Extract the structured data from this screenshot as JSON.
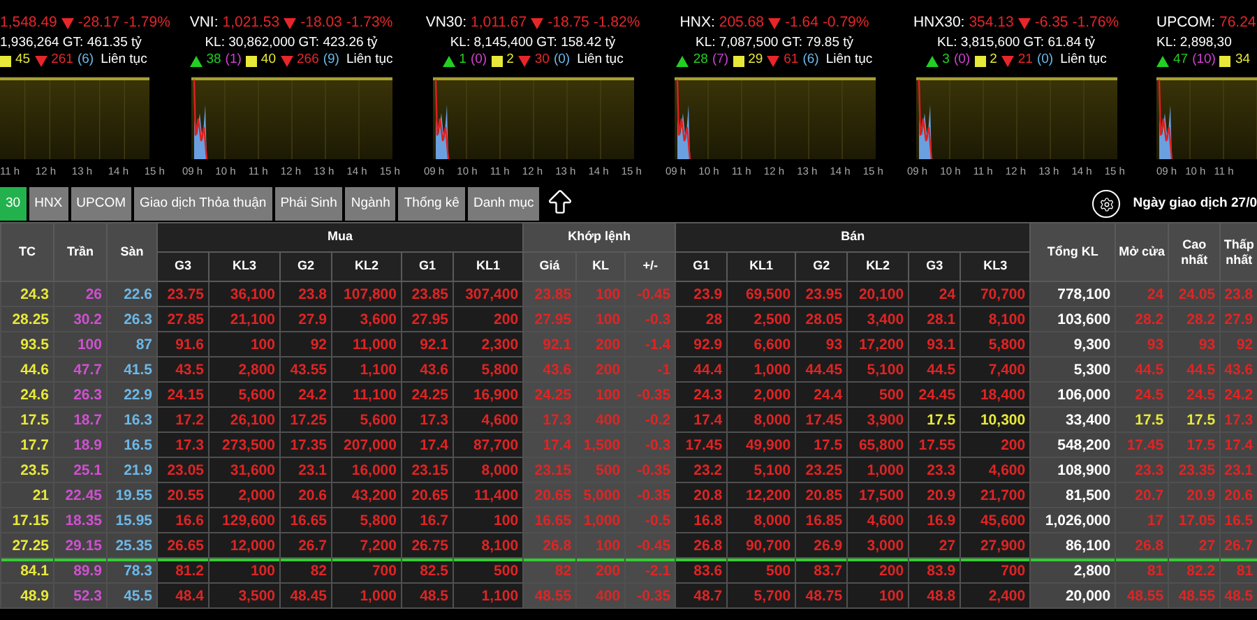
{
  "indices": [
    {
      "cut_left": true,
      "value": "1,548.49",
      "down": true,
      "change": "-28.17",
      "percent": "-1.79%",
      "stats": "1,936,264 GT: 461.35 tỷ",
      "breadth": {
        "unchanged": "45",
        "declines": "261",
        "floor": "(6)",
        "session": "Liên tục"
      },
      "x_labels": [
        "11 h",
        "12 h",
        "13 h",
        "14 h",
        "15 h"
      ]
    },
    {
      "label": "VNI:",
      "value": "1,021.53",
      "down": true,
      "change": "-18.03",
      "percent": "-1.73%",
      "stats": "KL: 30,862,000 GT: 423.26 tỷ",
      "breadth": {
        "advances": "38",
        "ceiling": "(1)",
        "unchanged": "40",
        "declines": "266",
        "floor": "(9)",
        "session": "Liên tục"
      },
      "x_labels": [
        "09 h",
        "10 h",
        "11 h",
        "12 h",
        "13 h",
        "14 h",
        "15 h"
      ]
    },
    {
      "label": "VN30:",
      "value": "1,011.67",
      "down": true,
      "change": "-18.75",
      "percent": "-1.82%",
      "stats": "KL: 8,145,400 GT: 158.42 tỷ",
      "breadth": {
        "advances": "1",
        "ceiling": "(0)",
        "unchanged": "2",
        "declines": "30",
        "floor": "(0)",
        "session": "Liên tục"
      },
      "x_labels": [
        "09 h",
        "10 h",
        "11 h",
        "12 h",
        "13 h",
        "14 h",
        "15 h"
      ]
    },
    {
      "label": "HNX:",
      "value": "205.68",
      "down": true,
      "change": "-1.64",
      "percent": "-0.79%",
      "stats": "KL: 7,087,500 GT: 79.85 tỷ",
      "breadth": {
        "advances": "28",
        "ceiling": "(7)",
        "unchanged": "29",
        "declines": "61",
        "floor": "(6)",
        "session": "Liên tục"
      },
      "x_labels": [
        "09 h",
        "10 h",
        "11 h",
        "12 h",
        "13 h",
        "14 h",
        "15 h"
      ]
    },
    {
      "label": "HNX30:",
      "value": "354.13",
      "down": true,
      "change": "-6.35",
      "percent": "-1.76%",
      "stats": "KL: 3,815,600 GT: 61.84 tỷ",
      "breadth": {
        "advances": "3",
        "ceiling": "(0)",
        "unchanged": "2",
        "declines": "21",
        "floor": "(0)",
        "session": "Liên tục"
      },
      "x_labels": [
        "09 h",
        "10 h",
        "11 h",
        "12 h",
        "13 h",
        "14 h",
        "15 h"
      ]
    },
    {
      "cut_right": true,
      "label": "UPCOM:",
      "value": "76.24",
      "down": true,
      "stats": "KL: 2,898,30",
      "breadth": {
        "advances": "47",
        "ceiling": "(10)",
        "unchanged": "34"
      },
      "x_labels": [
        "09 h",
        "10 h",
        "11 h"
      ]
    }
  ],
  "tabs": [
    {
      "label": "30",
      "selected": true
    },
    {
      "label": "HNX",
      "selected": false
    },
    {
      "label": "UPCOM",
      "selected": false
    },
    {
      "label": "Giao dịch Thỏa thuận",
      "selected": false
    },
    {
      "label": "Phái Sinh",
      "selected": false
    },
    {
      "label": "Ngành",
      "selected": false
    },
    {
      "label": "Thống kê",
      "selected": false
    },
    {
      "label": "Danh mục",
      "selected": false
    }
  ],
  "trading_date": "Ngày giao dịch 27/0",
  "table": {
    "groups": [
      {
        "kind": "single",
        "label": "TC"
      },
      {
        "kind": "single",
        "label": "Trần"
      },
      {
        "kind": "single",
        "label": "Sàn"
      },
      {
        "kind": "buy",
        "label": "Mua",
        "columns": [
          "G3",
          "KL3",
          "G2",
          "KL2",
          "G1",
          "KL1"
        ]
      },
      {
        "kind": "match",
        "label": "Khớp lệnh",
        "columns": [
          "Giá",
          "KL",
          "+/-"
        ]
      },
      {
        "kind": "sell",
        "label": "Bán",
        "columns": [
          "G1",
          "KL1",
          "G2",
          "KL2",
          "G3",
          "KL3"
        ]
      },
      {
        "kind": "single",
        "label": "Tổng KL"
      },
      {
        "kind": "single",
        "label": "Mở cửa"
      },
      {
        "kind": "single",
        "label": "Cao nhất"
      },
      {
        "kind": "single",
        "label": "Thấp nhất"
      }
    ],
    "rows": [
      {
        "separator_above": false,
        "cells": [
          {
            "text": "24.3",
            "color": "#e8e83a"
          },
          {
            "text": "26",
            "color": "#d050d0"
          },
          {
            "text": "22.6",
            "color": "#6cb8e8"
          },
          {
            "text": "23.75",
            "color": "#e02424"
          },
          {
            "text": "36,100",
            "color": "#e02424"
          },
          {
            "text": "23.8",
            "color": "#e02424"
          },
          {
            "text": "107,800",
            "color": "#e02424"
          },
          {
            "text": "23.85",
            "color": "#e02424"
          },
          {
            "text": "307,400",
            "color": "#e02424"
          },
          {
            "text": "23.85",
            "color": "#e02424"
          },
          {
            "text": "100",
            "color": "#e02424"
          },
          {
            "text": "-0.45",
            "color": "#e02424"
          },
          {
            "text": "23.9",
            "color": "#e02424"
          },
          {
            "text": "69,500",
            "color": "#e02424"
          },
          {
            "text": "23.95",
            "color": "#e02424"
          },
          {
            "text": "20,100",
            "color": "#e02424"
          },
          {
            "text": "24",
            "color": "#e02424"
          },
          {
            "text": "70,700",
            "color": "#e02424"
          },
          {
            "text": "778,100",
            "color": "#ffffff"
          },
          {
            "text": "24",
            "color": "#e02424"
          },
          {
            "text": "24.05",
            "color": "#e02424"
          },
          {
            "text": "23.8",
            "color": "#e02424"
          }
        ]
      },
      {
        "separator_above": false,
        "cells": [
          {
            "text": "28.25",
            "color": "#e8e83a"
          },
          {
            "text": "30.2",
            "color": "#d050d0"
          },
          {
            "text": "26.3",
            "color": "#6cb8e8"
          },
          {
            "text": "27.85",
            "color": "#e02424"
          },
          {
            "text": "21,100",
            "color": "#e02424"
          },
          {
            "text": "27.9",
            "color": "#e02424"
          },
          {
            "text": "3,600",
            "color": "#e02424"
          },
          {
            "text": "27.95",
            "color": "#e02424"
          },
          {
            "text": "200",
            "color": "#e02424"
          },
          {
            "text": "27.95",
            "color": "#e02424"
          },
          {
            "text": "100",
            "color": "#e02424"
          },
          {
            "text": "-0.3",
            "color": "#e02424"
          },
          {
            "text": "28",
            "color": "#e02424"
          },
          {
            "text": "2,500",
            "color": "#e02424"
          },
          {
            "text": "28.05",
            "color": "#e02424"
          },
          {
            "text": "3,400",
            "color": "#e02424"
          },
          {
            "text": "28.1",
            "color": "#e02424"
          },
          {
            "text": "8,100",
            "color": "#e02424"
          },
          {
            "text": "103,600",
            "color": "#ffffff"
          },
          {
            "text": "28.2",
            "color": "#e02424"
          },
          {
            "text": "28.2",
            "color": "#e02424"
          },
          {
            "text": "27.9",
            "color": "#e02424"
          }
        ]
      },
      {
        "separator_above": false,
        "cells": [
          {
            "text": "93.5",
            "color": "#e8e83a"
          },
          {
            "text": "100",
            "color": "#d050d0"
          },
          {
            "text": "87",
            "color": "#6cb8e8"
          },
          {
            "text": "91.6",
            "color": "#e02424"
          },
          {
            "text": "100",
            "color": "#e02424"
          },
          {
            "text": "92",
            "color": "#e02424"
          },
          {
            "text": "11,000",
            "color": "#e02424"
          },
          {
            "text": "92.1",
            "color": "#e02424"
          },
          {
            "text": "2,300",
            "color": "#e02424"
          },
          {
            "text": "92.1",
            "color": "#e02424"
          },
          {
            "text": "200",
            "color": "#e02424"
          },
          {
            "text": "-1.4",
            "color": "#e02424"
          },
          {
            "text": "92.9",
            "color": "#e02424"
          },
          {
            "text": "6,600",
            "color": "#e02424"
          },
          {
            "text": "93",
            "color": "#e02424"
          },
          {
            "text": "17,200",
            "color": "#e02424"
          },
          {
            "text": "93.1",
            "color": "#e02424"
          },
          {
            "text": "5,800",
            "color": "#e02424"
          },
          {
            "text": "9,300",
            "color": "#ffffff"
          },
          {
            "text": "93",
            "color": "#e02424"
          },
          {
            "text": "93",
            "color": "#e02424"
          },
          {
            "text": "92",
            "color": "#e02424"
          }
        ]
      },
      {
        "separator_above": false,
        "cells": [
          {
            "text": "44.6",
            "color": "#e8e83a"
          },
          {
            "text": "47.7",
            "color": "#d050d0"
          },
          {
            "text": "41.5",
            "color": "#6cb8e8"
          },
          {
            "text": "43.5",
            "color": "#e02424"
          },
          {
            "text": "2,800",
            "color": "#e02424"
          },
          {
            "text": "43.55",
            "color": "#e02424"
          },
          {
            "text": "1,100",
            "color": "#e02424"
          },
          {
            "text": "43.6",
            "color": "#e02424"
          },
          {
            "text": "5,800",
            "color": "#e02424"
          },
          {
            "text": "43.6",
            "color": "#e02424"
          },
          {
            "text": "200",
            "color": "#e02424"
          },
          {
            "text": "-1",
            "color": "#e02424"
          },
          {
            "text": "44.4",
            "color": "#e02424"
          },
          {
            "text": "1,000",
            "color": "#e02424"
          },
          {
            "text": "44.45",
            "color": "#e02424"
          },
          {
            "text": "5,100",
            "color": "#e02424"
          },
          {
            "text": "44.5",
            "color": "#e02424"
          },
          {
            "text": "7,400",
            "color": "#e02424"
          },
          {
            "text": "5,300",
            "color": "#ffffff"
          },
          {
            "text": "44.5",
            "color": "#e02424"
          },
          {
            "text": "44.5",
            "color": "#e02424"
          },
          {
            "text": "43.6",
            "color": "#e02424"
          }
        ]
      },
      {
        "separator_above": false,
        "cells": [
          {
            "text": "24.6",
            "color": "#e8e83a"
          },
          {
            "text": "26.3",
            "color": "#d050d0"
          },
          {
            "text": "22.9",
            "color": "#6cb8e8"
          },
          {
            "text": "24.15",
            "color": "#e02424"
          },
          {
            "text": "5,600",
            "color": "#e02424"
          },
          {
            "text": "24.2",
            "color": "#e02424"
          },
          {
            "text": "11,100",
            "color": "#e02424"
          },
          {
            "text": "24.25",
            "color": "#e02424"
          },
          {
            "text": "16,900",
            "color": "#e02424"
          },
          {
            "text": "24.25",
            "color": "#e02424"
          },
          {
            "text": "100",
            "color": "#e02424"
          },
          {
            "text": "-0.35",
            "color": "#e02424"
          },
          {
            "text": "24.3",
            "color": "#e02424"
          },
          {
            "text": "2,000",
            "color": "#e02424"
          },
          {
            "text": "24.4",
            "color": "#e02424"
          },
          {
            "text": "500",
            "color": "#e02424"
          },
          {
            "text": "24.45",
            "color": "#e02424"
          },
          {
            "text": "18,400",
            "color": "#e02424"
          },
          {
            "text": "106,000",
            "color": "#ffffff"
          },
          {
            "text": "24.5",
            "color": "#e02424"
          },
          {
            "text": "24.5",
            "color": "#e02424"
          },
          {
            "text": "24.2",
            "color": "#e02424"
          }
        ]
      },
      {
        "separator_above": false,
        "cells": [
          {
            "text": "17.5",
            "color": "#e8e83a"
          },
          {
            "text": "18.7",
            "color": "#d050d0"
          },
          {
            "text": "16.3",
            "color": "#6cb8e8"
          },
          {
            "text": "17.2",
            "color": "#e02424"
          },
          {
            "text": "26,100",
            "color": "#e02424"
          },
          {
            "text": "17.25",
            "color": "#e02424"
          },
          {
            "text": "5,600",
            "color": "#e02424"
          },
          {
            "text": "17.3",
            "color": "#e02424"
          },
          {
            "text": "4,600",
            "color": "#e02424"
          },
          {
            "text": "17.3",
            "color": "#e02424"
          },
          {
            "text": "400",
            "color": "#e02424"
          },
          {
            "text": "-0.2",
            "color": "#e02424"
          },
          {
            "text": "17.4",
            "color": "#e02424"
          },
          {
            "text": "8,000",
            "color": "#e02424"
          },
          {
            "text": "17.45",
            "color": "#e02424"
          },
          {
            "text": "3,900",
            "color": "#e02424"
          },
          {
            "text": "17.5",
            "color": "#e8e83a"
          },
          {
            "text": "10,300",
            "color": "#e8e83a"
          },
          {
            "text": "33,400",
            "color": "#ffffff"
          },
          {
            "text": "17.5",
            "color": "#e8e83a"
          },
          {
            "text": "17.5",
            "color": "#e8e83a"
          },
          {
            "text": "17.3",
            "color": "#e02424"
          }
        ]
      },
      {
        "separator_above": false,
        "cells": [
          {
            "text": "17.7",
            "color": "#e8e83a"
          },
          {
            "text": "18.9",
            "color": "#d050d0"
          },
          {
            "text": "16.5",
            "color": "#6cb8e8"
          },
          {
            "text": "17.3",
            "color": "#e02424"
          },
          {
            "text": "273,500",
            "color": "#e02424"
          },
          {
            "text": "17.35",
            "color": "#e02424"
          },
          {
            "text": "207,000",
            "color": "#e02424"
          },
          {
            "text": "17.4",
            "color": "#e02424"
          },
          {
            "text": "87,700",
            "color": "#e02424"
          },
          {
            "text": "17.4",
            "color": "#e02424"
          },
          {
            "text": "1,500",
            "color": "#e02424"
          },
          {
            "text": "-0.3",
            "color": "#e02424"
          },
          {
            "text": "17.45",
            "color": "#e02424"
          },
          {
            "text": "49,900",
            "color": "#e02424"
          },
          {
            "text": "17.5",
            "color": "#e02424"
          },
          {
            "text": "65,800",
            "color": "#e02424"
          },
          {
            "text": "17.55",
            "color": "#e02424"
          },
          {
            "text": "200",
            "color": "#e02424"
          },
          {
            "text": "548,200",
            "color": "#ffffff"
          },
          {
            "text": "17.45",
            "color": "#e02424"
          },
          {
            "text": "17.5",
            "color": "#e02424"
          },
          {
            "text": "17.4",
            "color": "#e02424"
          }
        ]
      },
      {
        "separator_above": false,
        "cells": [
          {
            "text": "23.5",
            "color": "#e8e83a"
          },
          {
            "text": "25.1",
            "color": "#d050d0"
          },
          {
            "text": "21.9",
            "color": "#6cb8e8"
          },
          {
            "text": "23.05",
            "color": "#e02424"
          },
          {
            "text": "31,600",
            "color": "#e02424"
          },
          {
            "text": "23.1",
            "color": "#e02424"
          },
          {
            "text": "16,000",
            "color": "#e02424"
          },
          {
            "text": "23.15",
            "color": "#e02424"
          },
          {
            "text": "8,000",
            "color": "#e02424"
          },
          {
            "text": "23.15",
            "color": "#e02424"
          },
          {
            "text": "500",
            "color": "#e02424"
          },
          {
            "text": "-0.35",
            "color": "#e02424"
          },
          {
            "text": "23.2",
            "color": "#e02424"
          },
          {
            "text": "5,100",
            "color": "#e02424"
          },
          {
            "text": "23.25",
            "color": "#e02424"
          },
          {
            "text": "1,000",
            "color": "#e02424"
          },
          {
            "text": "23.3",
            "color": "#e02424"
          },
          {
            "text": "4,600",
            "color": "#e02424"
          },
          {
            "text": "108,900",
            "color": "#ffffff"
          },
          {
            "text": "23.3",
            "color": "#e02424"
          },
          {
            "text": "23.35",
            "color": "#e02424"
          },
          {
            "text": "23.1",
            "color": "#e02424"
          }
        ]
      },
      {
        "separator_above": false,
        "cells": [
          {
            "text": "21",
            "color": "#e8e83a"
          },
          {
            "text": "22.45",
            "color": "#d050d0"
          },
          {
            "text": "19.55",
            "color": "#6cb8e8"
          },
          {
            "text": "20.55",
            "color": "#e02424"
          },
          {
            "text": "2,000",
            "color": "#e02424"
          },
          {
            "text": "20.6",
            "color": "#e02424"
          },
          {
            "text": "43,200",
            "color": "#e02424"
          },
          {
            "text": "20.65",
            "color": "#e02424"
          },
          {
            "text": "11,400",
            "color": "#e02424"
          },
          {
            "text": "20.65",
            "color": "#e02424"
          },
          {
            "text": "5,000",
            "color": "#e02424"
          },
          {
            "text": "-0.35",
            "color": "#e02424"
          },
          {
            "text": "20.8",
            "color": "#e02424"
          },
          {
            "text": "12,200",
            "color": "#e02424"
          },
          {
            "text": "20.85",
            "color": "#e02424"
          },
          {
            "text": "17,500",
            "color": "#e02424"
          },
          {
            "text": "20.9",
            "color": "#e02424"
          },
          {
            "text": "21,700",
            "color": "#e02424"
          },
          {
            "text": "81,500",
            "color": "#ffffff"
          },
          {
            "text": "20.7",
            "color": "#e02424"
          },
          {
            "text": "20.9",
            "color": "#e02424"
          },
          {
            "text": "20.6",
            "color": "#e02424"
          }
        ]
      },
      {
        "separator_above": false,
        "cells": [
          {
            "text": "17.15",
            "color": "#e8e83a"
          },
          {
            "text": "18.35",
            "color": "#d050d0"
          },
          {
            "text": "15.95",
            "color": "#6cb8e8"
          },
          {
            "text": "16.6",
            "color": "#e02424"
          },
          {
            "text": "129,600",
            "color": "#e02424"
          },
          {
            "text": "16.65",
            "color": "#e02424"
          },
          {
            "text": "5,800",
            "color": "#e02424"
          },
          {
            "text": "16.7",
            "color": "#e02424"
          },
          {
            "text": "100",
            "color": "#e02424"
          },
          {
            "text": "16.65",
            "color": "#e02424"
          },
          {
            "text": "1,000",
            "color": "#e02424"
          },
          {
            "text": "-0.5",
            "color": "#e02424"
          },
          {
            "text": "16.8",
            "color": "#e02424"
          },
          {
            "text": "8,000",
            "color": "#e02424"
          },
          {
            "text": "16.85",
            "color": "#e02424"
          },
          {
            "text": "4,600",
            "color": "#e02424"
          },
          {
            "text": "16.9",
            "color": "#e02424"
          },
          {
            "text": "45,600",
            "color": "#e02424"
          },
          {
            "text": "1,026,000",
            "color": "#ffffff"
          },
          {
            "text": "17",
            "color": "#e02424"
          },
          {
            "text": "17.05",
            "color": "#e02424"
          },
          {
            "text": "16.5",
            "color": "#e02424"
          }
        ]
      },
      {
        "separator_above": false,
        "cells": [
          {
            "text": "27.25",
            "color": "#e8e83a"
          },
          {
            "text": "29.15",
            "color": "#d050d0"
          },
          {
            "text": "25.35",
            "color": "#6cb8e8"
          },
          {
            "text": "26.65",
            "color": "#e02424"
          },
          {
            "text": "12,000",
            "color": "#e02424"
          },
          {
            "text": "26.7",
            "color": "#e02424"
          },
          {
            "text": "7,200",
            "color": "#e02424"
          },
          {
            "text": "26.75",
            "color": "#e02424"
          },
          {
            "text": "8,100",
            "color": "#e02424"
          },
          {
            "text": "26.8",
            "color": "#e02424"
          },
          {
            "text": "100",
            "color": "#e02424"
          },
          {
            "text": "-0.45",
            "color": "#e02424"
          },
          {
            "text": "26.8",
            "color": "#e02424"
          },
          {
            "text": "90,700",
            "color": "#e02424"
          },
          {
            "text": "26.9",
            "color": "#e02424"
          },
          {
            "text": "3,000",
            "color": "#e02424"
          },
          {
            "text": "27",
            "color": "#e02424"
          },
          {
            "text": "27,900",
            "color": "#e02424"
          },
          {
            "text": "86,100",
            "color": "#ffffff"
          },
          {
            "text": "26.8",
            "color": "#e02424"
          },
          {
            "text": "27",
            "color": "#e02424"
          },
          {
            "text": "26.7",
            "color": "#e02424"
          }
        ]
      },
      {
        "separator_above": true,
        "cells": [
          {
            "text": "84.1",
            "color": "#e8e83a"
          },
          {
            "text": "89.9",
            "color": "#d050d0"
          },
          {
            "text": "78.3",
            "color": "#6cb8e8"
          },
          {
            "text": "81.2",
            "color": "#e02424"
          },
          {
            "text": "100",
            "color": "#e02424"
          },
          {
            "text": "82",
            "color": "#e02424"
          },
          {
            "text": "700",
            "color": "#e02424"
          },
          {
            "text": "82.5",
            "color": "#e02424"
          },
          {
            "text": "500",
            "color": "#e02424"
          },
          {
            "text": "82",
            "color": "#e02424"
          },
          {
            "text": "200",
            "color": "#e02424"
          },
          {
            "text": "-2.1",
            "color": "#e02424"
          },
          {
            "text": "83.6",
            "color": "#e02424"
          },
          {
            "text": "500",
            "color": "#e02424"
          },
          {
            "text": "83.7",
            "color": "#e02424"
          },
          {
            "text": "200",
            "color": "#e02424"
          },
          {
            "text": "83.9",
            "color": "#e02424"
          },
          {
            "text": "700",
            "color": "#e02424"
          },
          {
            "text": "2,800",
            "color": "#ffffff"
          },
          {
            "text": "81",
            "color": "#e02424"
          },
          {
            "text": "82.2",
            "color": "#e02424"
          },
          {
            "text": "81",
            "color": "#e02424"
          }
        ]
      },
      {
        "separator_above": false,
        "cells": [
          {
            "text": "48.9",
            "color": "#e8e83a"
          },
          {
            "text": "52.3",
            "color": "#d050d0"
          },
          {
            "text": "45.5",
            "color": "#6cb8e8"
          },
          {
            "text": "48.4",
            "color": "#e02424"
          },
          {
            "text": "3,500",
            "color": "#e02424"
          },
          {
            "text": "48.45",
            "color": "#e02424"
          },
          {
            "text": "1,000",
            "color": "#e02424"
          },
          {
            "text": "48.5",
            "color": "#e02424"
          },
          {
            "text": "1,100",
            "color": "#e02424"
          },
          {
            "text": "48.55",
            "color": "#e02424"
          },
          {
            "text": "400",
            "color": "#e02424"
          },
          {
            "text": "-0.35",
            "color": "#e02424"
          },
          {
            "text": "48.7",
            "color": "#e02424"
          },
          {
            "text": "5,700",
            "color": "#e02424"
          },
          {
            "text": "48.75",
            "color": "#e02424"
          },
          {
            "text": "100",
            "color": "#e02424"
          },
          {
            "text": "48.8",
            "color": "#e02424"
          },
          {
            "text": "2,400",
            "color": "#e02424"
          },
          {
            "text": "20,000",
            "color": "#ffffff"
          },
          {
            "text": "48.55",
            "color": "#e02424"
          },
          {
            "text": "48.55",
            "color": "#e02424"
          },
          {
            "text": "48.5",
            "color": "#e02424"
          }
        ]
      }
    ]
  }
}
